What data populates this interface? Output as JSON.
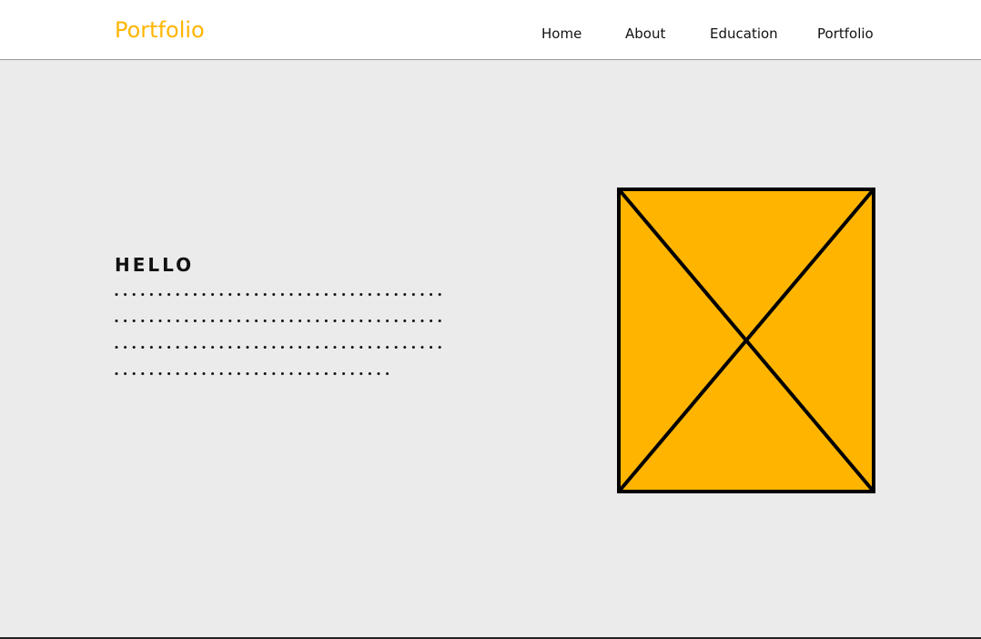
{
  "header": {
    "brand": "Portfolio",
    "nav": [
      {
        "label": "Home"
      },
      {
        "label": "About"
      },
      {
        "label": "Education"
      },
      {
        "label": "Portfolio"
      }
    ]
  },
  "hero": {
    "title": "HELLO"
  },
  "colors": {
    "accent": "#FFB500",
    "background": "#EBEBEB",
    "header_bg": "#FFFFFF",
    "text": "#111111"
  },
  "icons": {
    "hero_image": "image-placeholder"
  }
}
